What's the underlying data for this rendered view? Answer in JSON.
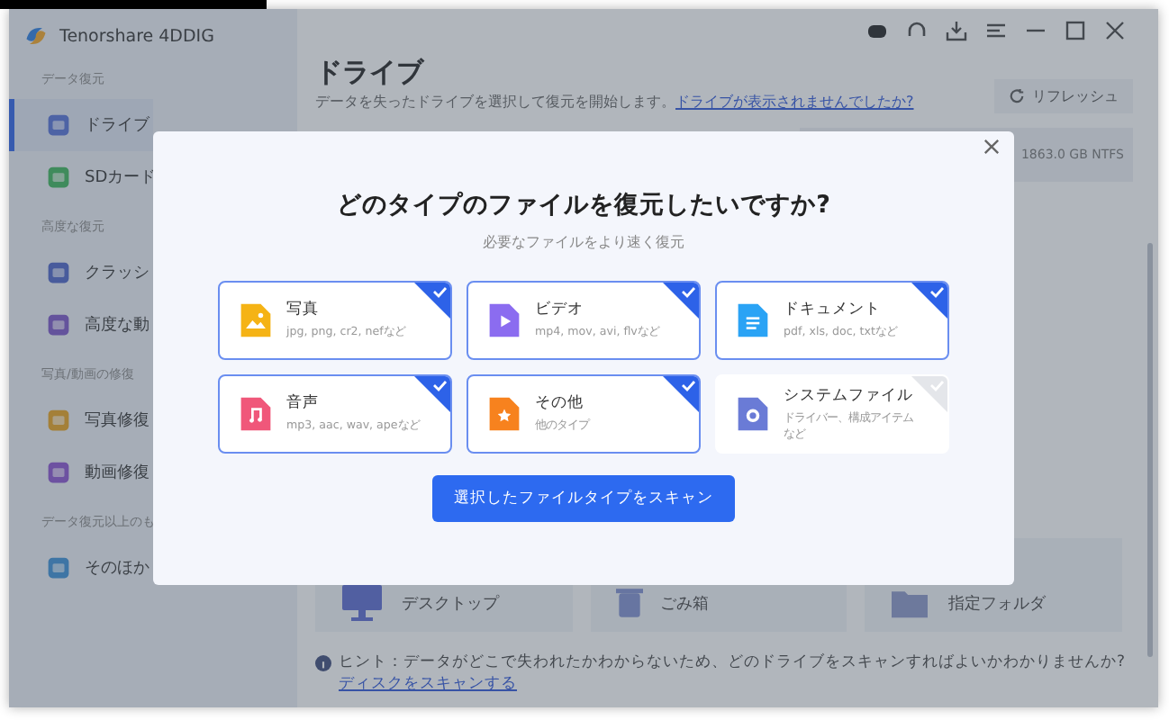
{
  "window": {
    "title": "Tenorshare 4DDIG"
  },
  "sidebar": {
    "sections": [
      {
        "heading": "データ復元",
        "items": [
          {
            "label": "ドライブ",
            "selected": true
          },
          {
            "label": "SDカード",
            "selected": false
          }
        ]
      },
      {
        "heading": "高度な復元",
        "items": [
          {
            "label": "クラッシ",
            "selected": false
          },
          {
            "label": "高度な動",
            "selected": false
          }
        ]
      },
      {
        "heading": "写真/動画の修復",
        "items": [
          {
            "label": "写真修復",
            "selected": false
          },
          {
            "label": "動画修復",
            "selected": false
          }
        ]
      },
      {
        "heading": "データ復元以上のも",
        "items": [
          {
            "label": "そのほか",
            "selected": false
          }
        ]
      }
    ]
  },
  "main": {
    "title": "ドライブ",
    "description": "データを失ったドライブを選択して復元を開始します。",
    "help_link": "ドライブが表示されませんでしたか?",
    "refresh": "リフレッシュ",
    "disk_info": "1863.0 GB NTFS",
    "locations": [
      {
        "label": "デスクトップ"
      },
      {
        "label": "ごみ箱"
      },
      {
        "label": "指定フォルダ"
      }
    ],
    "hint": "ヒント：データがどこで失われたかわからないため、どのドライブをスキャンすればよいかわかりませんか?",
    "hint_link": "ディスクをスキャンする"
  },
  "dialog": {
    "title": "どのタイプのファイルを復元したいですか?",
    "subtitle": "必要なファイルをより速く復元",
    "file_types": [
      {
        "name": "写真",
        "formats": "jpg, png, cr2, nefなど",
        "checked": true
      },
      {
        "name": "ビデオ",
        "formats": "mp4, mov, avi, flvなど",
        "checked": true
      },
      {
        "name": "ドキュメント",
        "formats": "pdf, xls, doc, txtなど",
        "checked": true
      },
      {
        "name": "音声",
        "formats": "mp3, aac, wav, apeなど",
        "checked": true
      },
      {
        "name": "その他",
        "formats": "他のタイプ",
        "checked": true
      },
      {
        "name": "システムファイル",
        "formats": "ドライバー、構成アイテムなど",
        "checked": false
      }
    ],
    "scan_button": "選択したファイルタイプをスキャン"
  }
}
